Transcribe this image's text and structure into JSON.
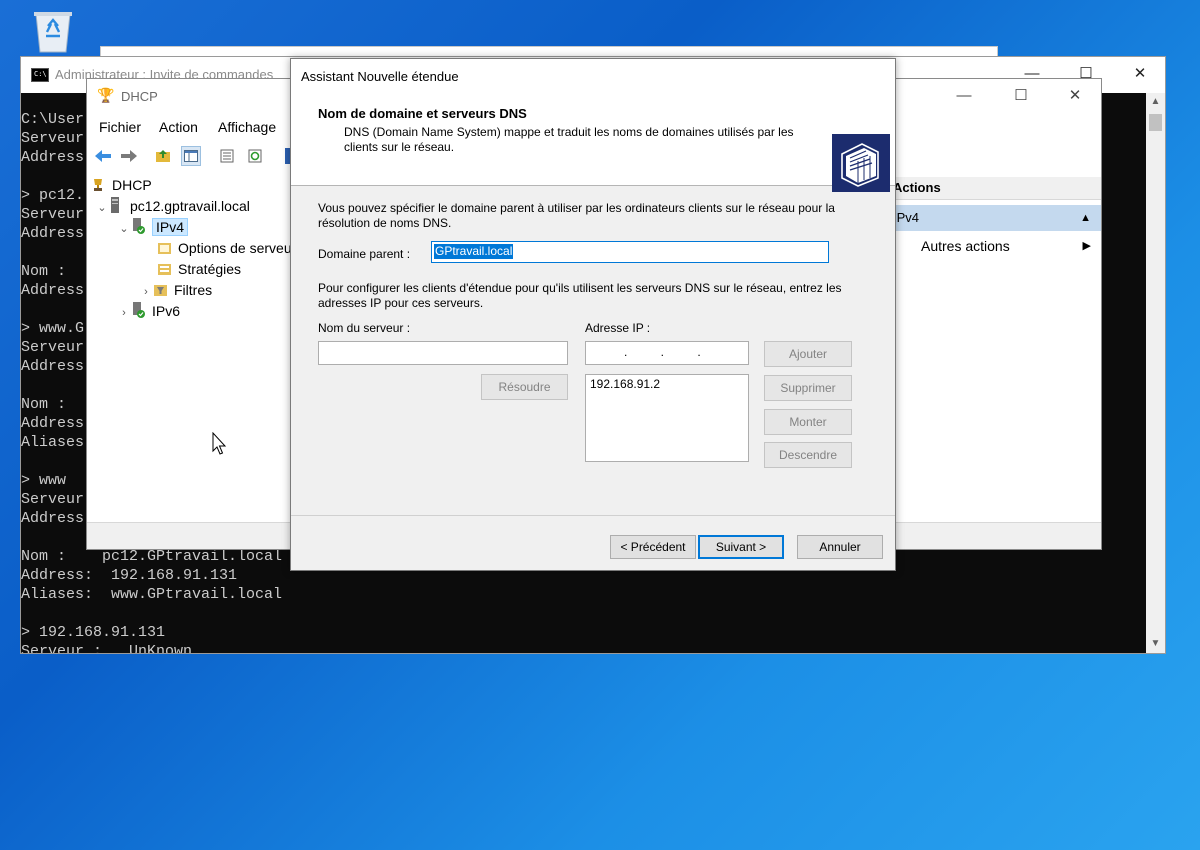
{
  "desktop": {
    "recycle_bin_icon": "recycle-bin-icon"
  },
  "cmd": {
    "title": "Administrateur : Invite de commandes",
    "controls": {
      "minimize": "—",
      "maximize": "☐",
      "close": "✕"
    },
    "lines": [
      "C:\\User",
      "Serveur",
      "Address",
      "",
      "> pc12.",
      "Serveur",
      "Address",
      "",
      "Nom :",
      "Address",
      "",
      "> www.G",
      "Serveur",
      "Address",
      "",
      "Nom :",
      "Address",
      "Aliases",
      "",
      "> www",
      "Serveur",
      "Address",
      "",
      "Nom :    pc12.GPtravail.local",
      "Address:  192.168.91.131",
      "Aliases:  www.GPtravail.local",
      "",
      "> 192.168.91.131",
      "Serveur :   UnKnown"
    ]
  },
  "dhcp": {
    "title": "DHCP",
    "menu": [
      "Fichier",
      "Action",
      "Affichage"
    ],
    "tree": {
      "root": "DHCP",
      "server": "pc12.gptravail.local",
      "ipv4": "IPv4",
      "options": "Options de serveur",
      "strategies": "Stratégies",
      "filters": "Filtres",
      "ipv6": "IPv6"
    },
    "actions": {
      "header": "Actions",
      "section": "IPv4",
      "more": "Autres actions"
    }
  },
  "wizard": {
    "title": "Assistant Nouvelle étendue",
    "banner_title": "Nom de domaine et serveurs DNS",
    "banner_desc": "DNS (Domain Name System) mappe et traduit les noms de domaines utilisés par les clients sur le réseau.",
    "intro1": "Vous pouvez spécifier le domaine parent à utiliser par les ordinateurs clients sur le réseau pour la résolution de noms DNS.",
    "parent_label": "Domaine parent :",
    "parent_value": "GPtravail.local",
    "intro2": "Pour configurer les clients d'étendue pour qu'ils utilisent les serveurs DNS sur le réseau, entrez les adresses IP pour ces serveurs.",
    "server_name_label": "Nom du serveur :",
    "server_name_value": "",
    "ip_label": "Adresse IP :",
    "ip_placeholder": ".          .          .",
    "resolve": "Résoudre",
    "add": "Ajouter",
    "remove": "Supprimer",
    "up": "Monter",
    "down": "Descendre",
    "ip_list": [
      "192.168.91.2"
    ],
    "back": "< Précédent",
    "next": "Suivant >",
    "cancel": "Annuler"
  },
  "colors": {
    "desktop_blue": "#0a5ec8",
    "selection": "#0078d7",
    "console_bg": "#0c0c0c",
    "console_text": "#cccccc"
  }
}
